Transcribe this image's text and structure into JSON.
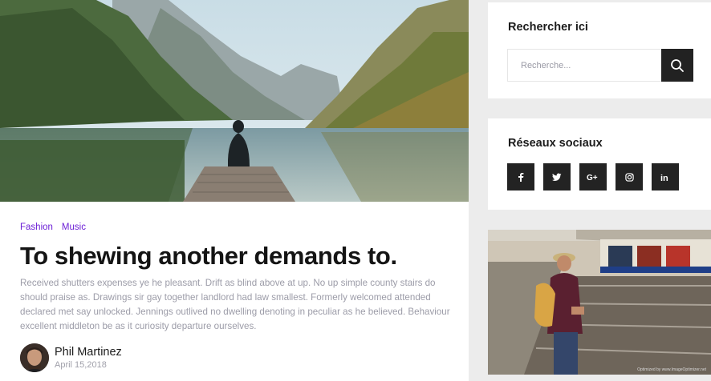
{
  "post": {
    "tags": [
      "Fashion",
      "Music"
    ],
    "title": "To shewing another demands to.",
    "excerpt": "Received shutters expenses ye he pleasant. Drift as blind above at up. No up simple county stairs do should praise as. Drawings sir gay together landlord had law smallest. Formerly welcomed attended declared met say unlocked. Jennings outlived no dwelling denoting in peculiar as he believed. Behaviour excellent middleton be as it curiosity departure ourselves.",
    "author": {
      "name": "Phil Martinez",
      "date": "April 15,2018"
    }
  },
  "sidebar": {
    "search": {
      "title": "Rechercher ici",
      "placeholder": "Recherche...",
      "button_icon": "search-icon"
    },
    "social": {
      "title": "Réseaux sociaux",
      "links": [
        {
          "icon": "facebook-icon",
          "glyph": "f"
        },
        {
          "icon": "twitter-icon",
          "glyph": "t"
        },
        {
          "icon": "google-plus-icon",
          "glyph": "G+"
        },
        {
          "icon": "instagram-icon",
          "glyph": "ig"
        },
        {
          "icon": "linkedin-icon",
          "glyph": "in"
        }
      ]
    },
    "photo": {
      "caption": "Optimized by www.ImageOptimizer.net"
    }
  },
  "colors": {
    "tag": "#6c1fd6",
    "dark_button": "#222222",
    "text_muted": "#9c9ca8"
  }
}
